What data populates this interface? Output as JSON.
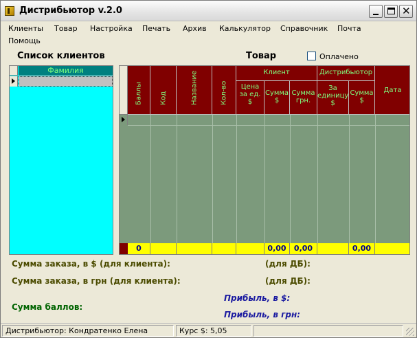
{
  "window": {
    "title": "Дистрибьютор v.2.0"
  },
  "menu": [
    "Клиенты",
    "Товар",
    "Настройка",
    "Печать",
    "Архив",
    "Калькулятор",
    "Справочник",
    "Почта",
    "Помощь"
  ],
  "clients": {
    "heading": "Список клиентов",
    "column": "Фамилия"
  },
  "goods": {
    "heading": "Товар",
    "paid_label": "Оплачено",
    "paid_checked": false,
    "columns": {
      "points": "Баллы",
      "code": "Код",
      "name": "Название",
      "qty": "Кол-во",
      "client_group": "Клиент",
      "client_price": "Цена за ед. $",
      "client_sum_usd": "Сумма $",
      "client_sum_uah": "Сумма грн.",
      "distributor_group": "Дистрибьютор",
      "dist_per_unit": "За единицу $",
      "dist_sum_usd": "Сумма $",
      "date": "Дата"
    },
    "totals": {
      "points": "0",
      "client_sum_usd": "0,00",
      "client_sum_uah": "0,00",
      "dist_sum_usd": "0,00"
    }
  },
  "summary": {
    "order_usd_client": "Сумма заказа, в $ (для клиента):",
    "order_usd_db": "(для ДБ):",
    "order_uah_client": "Сумма заказа, в грн (для клиента):",
    "order_uah_db": "(для ДБ):",
    "points_sum": "Сумма баллов:",
    "profit_usd": "Прибыль, в $:",
    "profit_uah": "Прибыль, в грн:"
  },
  "status": {
    "distributor": "Дистрибьютор:  Кондратенко Елена",
    "rate": "Курс $:  5,05"
  },
  "colors": {
    "client_grid_bg": "#00ffff",
    "header_bg": "#800000",
    "header_text": "#7fff7f",
    "goods_bg": "#7c9a7c",
    "totals_bg": "#ffff00"
  }
}
